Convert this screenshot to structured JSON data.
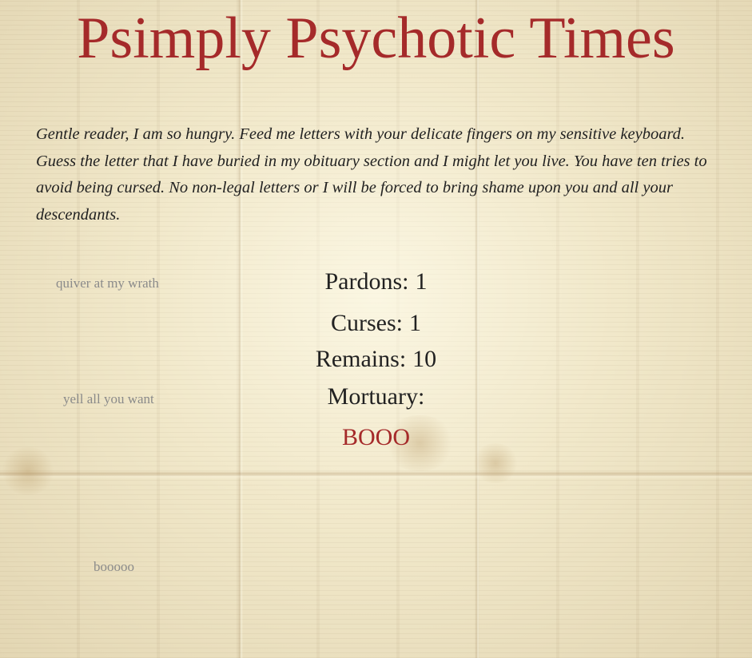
{
  "header": {
    "title": "Psimply Psychotic Times"
  },
  "intro": {
    "text": "Gentle reader, I am so hungry. Feed me letters with your delicate fingers on my sensitive keyboard. Guess the letter that I have buried in my obituary section and I might let you live. You have ten tries to avoid being cursed. No non-legal letters or I will be forced to bring shame upon you and all your descendants."
  },
  "side_notes": [
    "quiver at my wrath",
    "yell all you want",
    "booooo"
  ],
  "stats": {
    "pardons_label": "Pardons:",
    "pardons_value": "1",
    "curses_label": "Curses:",
    "curses_value": "1",
    "remains_label": "Remains:",
    "remains_value": "10",
    "mortuary_label": "Mortuary:",
    "mortuary_value": "BOOO"
  },
  "colors": {
    "title_red": "#a52a2a",
    "text_dark": "#222222",
    "note_gray": "#8a8a8a",
    "paper": "#efe6c8"
  }
}
